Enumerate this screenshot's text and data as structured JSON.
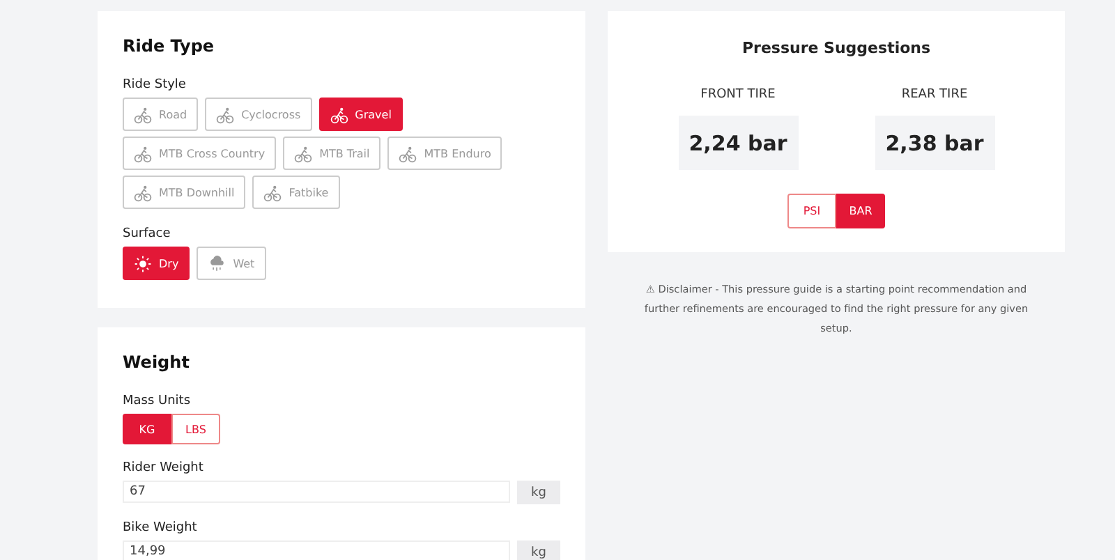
{
  "ride_type": {
    "title": "Ride Type",
    "ride_style": {
      "label": "Ride Style",
      "options": [
        {
          "label": "Road",
          "selected": false
        },
        {
          "label": "Cyclocross",
          "selected": false
        },
        {
          "label": "Gravel",
          "selected": true
        },
        {
          "label": "MTB Cross Country",
          "selected": false
        },
        {
          "label": "MTB Trail",
          "selected": false
        },
        {
          "label": "MTB Enduro",
          "selected": false
        },
        {
          "label": "MTB Downhill",
          "selected": false
        },
        {
          "label": "Fatbike",
          "selected": false
        }
      ]
    },
    "surface": {
      "label": "Surface",
      "options": [
        {
          "kind": "sun",
          "label": "Dry",
          "selected": true
        },
        {
          "kind": "rain",
          "label": "Wet",
          "selected": false
        }
      ]
    }
  },
  "weight": {
    "title": "Weight",
    "mass_units": {
      "label": "Mass Units",
      "options": [
        {
          "label": "KG",
          "selected": true
        },
        {
          "label": "LBS",
          "selected": false
        }
      ]
    },
    "fields": [
      {
        "label": "Rider Weight",
        "value": "67",
        "unit": "kg"
      },
      {
        "label": "Bike Weight",
        "value": "14,99",
        "unit": "kg"
      }
    ]
  },
  "pressure": {
    "title": "Pressure Suggestions",
    "tires": [
      {
        "label": "FRONT TIRE",
        "value": "2,24 bar"
      },
      {
        "label": "REAR TIRE",
        "value": "2,38 bar"
      }
    ],
    "units": [
      {
        "label": "PSI",
        "selected": false
      },
      {
        "label": "BAR",
        "selected": true
      }
    ]
  },
  "disclaimer": "⚠ Disclaimer - This pressure guide is a starting point recommendation and further refinements are encouraged to find the right pressure for any given setup."
}
